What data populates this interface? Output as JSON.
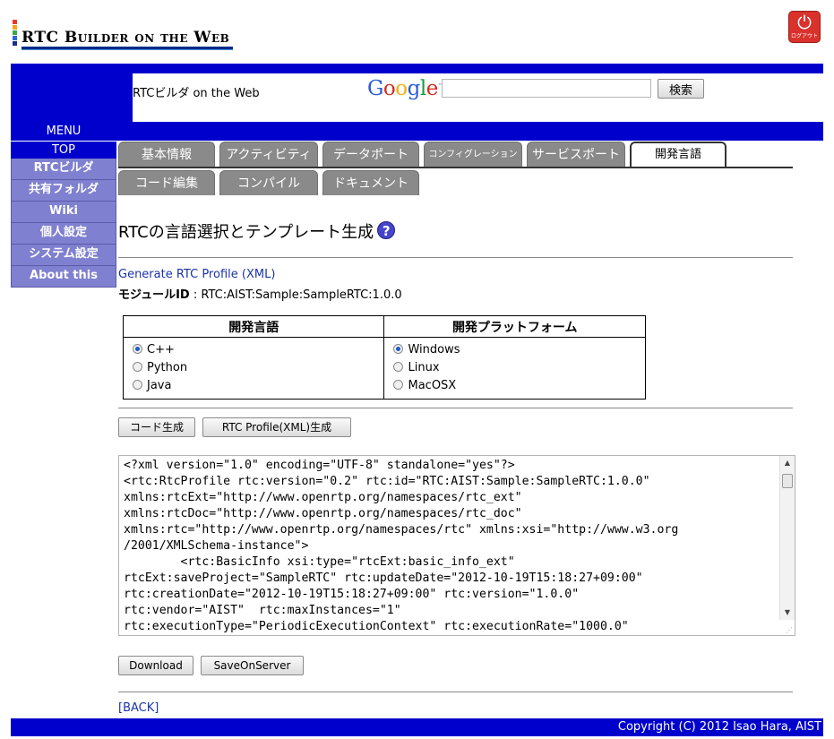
{
  "logo": {
    "text": "RTC Builder on the Web",
    "bar_colors": [
      "#e63b2e",
      "#f2a31c",
      "#3aa84a",
      "#2d6ad8",
      "#1b2f8a"
    ]
  },
  "logout": {
    "glyph": "⏻",
    "label": "ログアウト"
  },
  "header": {
    "title": "RTCビルダ on the Web",
    "search_placeholder": "",
    "search_button": "検索",
    "menu_label": "MENU"
  },
  "google_logo": {
    "letters": [
      "G",
      "o",
      "o",
      "g",
      "l",
      "e"
    ],
    "colors": [
      "#2a5bd6",
      "#d62d20",
      "#f2b20f",
      "#2a5bd6",
      "#169c3d",
      "#d62d20"
    ],
    "tm": "™"
  },
  "sidebar": {
    "items": [
      {
        "label": "TOP"
      },
      {
        "label": "RTCビルダ"
      },
      {
        "label": "共有フォルダ"
      },
      {
        "label": "Wiki"
      },
      {
        "label": "個人設定"
      },
      {
        "label": "システム設定"
      },
      {
        "label": "About this"
      }
    ]
  },
  "tabs": {
    "row1": [
      "基本情報",
      "アクティビティ",
      "データポート",
      "コンフィグレーション",
      "サービスポート",
      "開発言語"
    ],
    "row2": [
      "コード編集",
      "コンパイル",
      "ドキュメント"
    ],
    "active": "開発言語"
  },
  "page": {
    "heading": "RTCの言語選択とテンプレート生成",
    "help_glyph": "?",
    "generate_link": "Generate RTC Profile (XML)",
    "module_id_label": "モジュールID",
    "module_id_value": ": RTC:AIST:Sample:SampleRTC:1.0.0"
  },
  "options": {
    "lang_header": "開発言語",
    "platform_header": "開発プラットフォーム",
    "languages": [
      {
        "label": "C++",
        "selected": true
      },
      {
        "label": "Python",
        "selected": false
      },
      {
        "label": "Java",
        "selected": false
      }
    ],
    "platforms": [
      {
        "label": "Windows",
        "selected": true
      },
      {
        "label": "Linux",
        "selected": false
      },
      {
        "label": "MacOSX",
        "selected": false
      }
    ]
  },
  "actions": {
    "code_gen": "コード生成",
    "profile_gen": "RTC Profile(XML)生成"
  },
  "code": {
    "text": "<?xml version=\"1.0\" encoding=\"UTF-8\" standalone=\"yes\"?>\n<rtc:RtcProfile rtc:version=\"0.2\" rtc:id=\"RTC:AIST:Sample:SampleRTC:1.0.0\"\nxmlns:rtcExt=\"http://www.openrtp.org/namespaces/rtc_ext\"\nxmlns:rtcDoc=\"http://www.openrtp.org/namespaces/rtc_doc\"\nxmlns:rtc=\"http://www.openrtp.org/namespaces/rtc\" xmlns:xsi=\"http://www.w3.org\n/2001/XMLSchema-instance\">\n        <rtc:BasicInfo xsi:type=\"rtcExt:basic_info_ext\"\nrtcExt:saveProject=\"SampleRTC\" rtc:updateDate=\"2012-10-19T15:18:27+09:00\"\nrtc:creationDate=\"2012-10-19T15:18:27+09:00\" rtc:version=\"1.0.0\"\nrtc:vendor=\"AIST\"  rtc:maxInstances=\"1\"\nrtc:executionType=\"PeriodicExecutionContext\" rtc:executionRate=\"1000.0\""
  },
  "downloads": {
    "download": "Download",
    "save_on_server": "SaveOnServer"
  },
  "back_link": "[BACK]",
  "footer": "Copyright (C) 2012 Isao Hara, AIST"
}
